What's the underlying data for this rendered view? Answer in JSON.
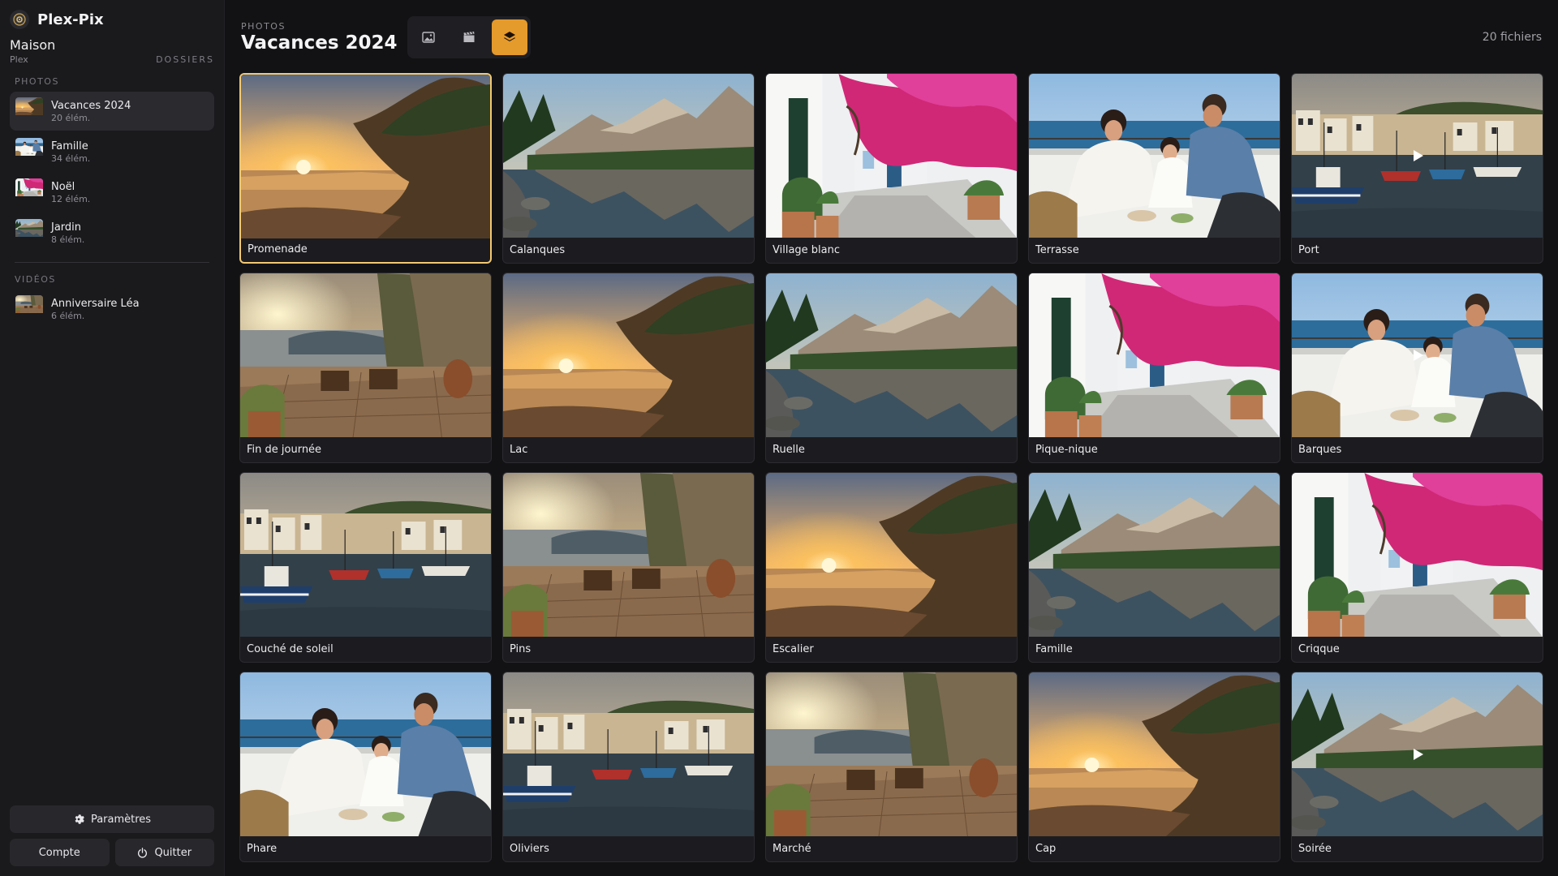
{
  "app": {
    "name": "Plex-Pix",
    "server": "Maison",
    "server_sub": "Plex",
    "folders_label": "DOSSIERS"
  },
  "sidebar": {
    "photos_label": "PHOTOS",
    "videos_label": "VIDÉOS",
    "photos": [
      {
        "label": "Vacances 2024",
        "count": "20 élém.",
        "thumb": "sunset",
        "active": true
      },
      {
        "label": "Famille",
        "count": "34 élém.",
        "thumb": "family",
        "active": false
      },
      {
        "label": "Noël",
        "count": "12 élém.",
        "thumb": "village",
        "active": false
      },
      {
        "label": "Jardin",
        "count": "8 élém.",
        "thumb": "lake",
        "active": false
      }
    ],
    "videos": [
      {
        "label": "Anniversaire Léa",
        "count": "6 élém.",
        "thumb": "terrace",
        "active": false
      }
    ],
    "settings_label": "Paramètres",
    "account_label": "Compte",
    "quit_label": "Quitter"
  },
  "header": {
    "crumb": "PHOTOS",
    "title": "Vacances 2024",
    "file_count": "20 fichiers",
    "modes": [
      "image-icon",
      "film-icon",
      "layers-icon"
    ],
    "active_mode": 2
  },
  "colors": {
    "accent": "#e59a2c",
    "selected_border": "#f2c870"
  },
  "tiles": [
    {
      "label": "Promenade",
      "scene": "sunset",
      "video": false,
      "selected": true
    },
    {
      "label": "Calanques",
      "scene": "lake",
      "video": false,
      "selected": false
    },
    {
      "label": "Village blanc",
      "scene": "village",
      "video": false,
      "selected": false
    },
    {
      "label": "Terrasse",
      "scene": "family",
      "video": false,
      "selected": false
    },
    {
      "label": "Port",
      "scene": "harbor",
      "video": true,
      "selected": false
    },
    {
      "label": "Fin de journée",
      "scene": "terrace",
      "video": false,
      "selected": false
    },
    {
      "label": "Lac",
      "scene": "sunset",
      "video": false,
      "selected": false
    },
    {
      "label": "Ruelle",
      "scene": "lake",
      "video": false,
      "selected": false
    },
    {
      "label": "Pique-nique",
      "scene": "village",
      "video": false,
      "selected": false
    },
    {
      "label": "Barques",
      "scene": "family",
      "video": true,
      "selected": false
    },
    {
      "label": "Couché de soleil",
      "scene": "harbor",
      "video": false,
      "selected": false
    },
    {
      "label": "Pins",
      "scene": "terrace",
      "video": false,
      "selected": false
    },
    {
      "label": "Escalier",
      "scene": "sunset",
      "video": false,
      "selected": false
    },
    {
      "label": "Famille",
      "scene": "lake",
      "video": false,
      "selected": false
    },
    {
      "label": "Criqque",
      "scene": "village",
      "video": false,
      "selected": false
    },
    {
      "label": "Phare",
      "scene": "family",
      "video": false,
      "selected": false
    },
    {
      "label": "Oliviers",
      "scene": "harbor",
      "video": false,
      "selected": false
    },
    {
      "label": "Marché",
      "scene": "terrace",
      "video": false,
      "selected": false
    },
    {
      "label": "Cap",
      "scene": "sunset",
      "video": false,
      "selected": false
    },
    {
      "label": "Soirée",
      "scene": "lake",
      "video": true,
      "selected": false
    }
  ]
}
